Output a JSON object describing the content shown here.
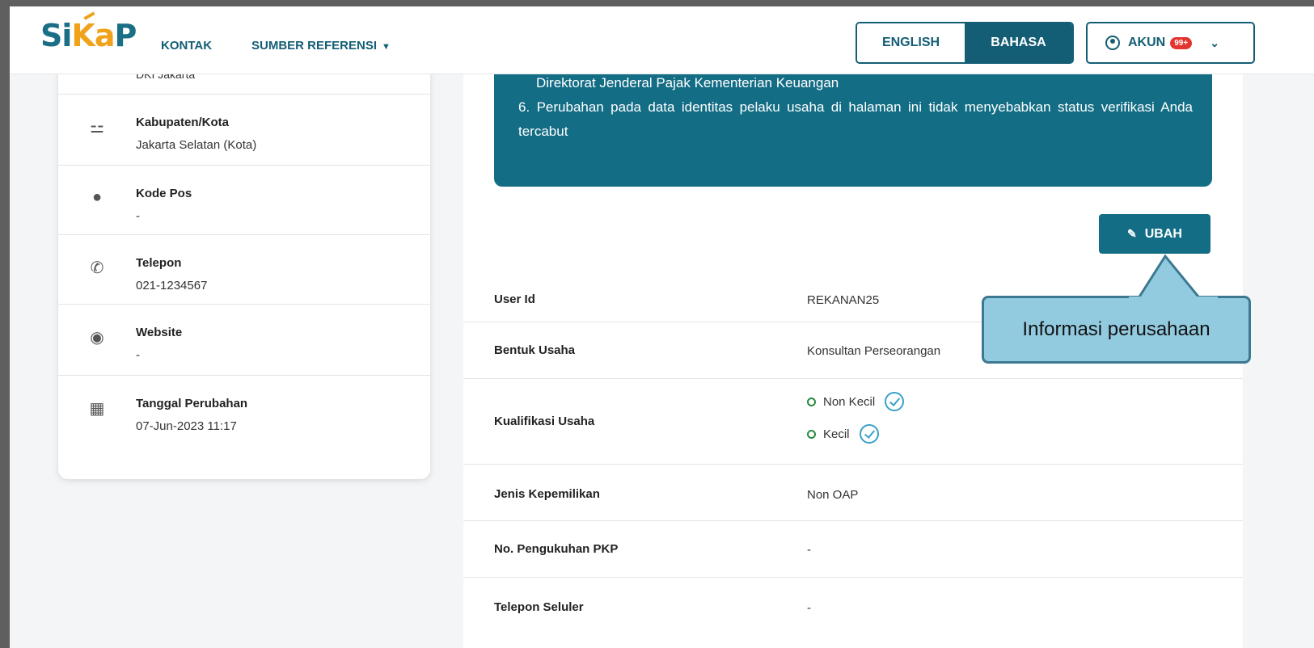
{
  "header": {
    "logo_text": "SiKaP",
    "nav": {
      "kontak": "KONTAK",
      "sumber_referensi": "SUMBER REFERENSI"
    },
    "lang": {
      "english": "ENGLISH",
      "bahasa": "BAHASA"
    },
    "akun": {
      "label": "AKUN",
      "badge": "99+"
    }
  },
  "left_card": {
    "cut_text": "DKI Jakarta",
    "items": [
      {
        "label": "Kabupaten/Kota",
        "value": "Jakarta Selatan (Kota)",
        "icon": "signpost-icon"
      },
      {
        "label": "Kode Pos",
        "value": "-",
        "icon": "pin-icon"
      },
      {
        "label": "Telepon",
        "value": "021-1234567",
        "icon": "phone-icon"
      },
      {
        "label": "Website",
        "value": "-",
        "icon": "globe-icon"
      },
      {
        "label": "Tanggal Perubahan",
        "value": "07-Jun-2023 11:17",
        "icon": "calendar-icon"
      }
    ]
  },
  "notice": {
    "line1": "Direktorat Jenderal Pajak Kementerian Keuangan",
    "item6": "6. Perubahan pada data identitas pelaku usaha di halaman ini tidak menyebabkan status verifikasi Anda tercabut"
  },
  "ubah_label": "UBAH",
  "details": {
    "user_id": {
      "label": "User Id",
      "value": "REKANAN25"
    },
    "bentuk_usaha": {
      "label": "Bentuk Usaha",
      "value": "Konsultan Perseorangan"
    },
    "kualifikasi": {
      "label": "Kualifikasi Usaha",
      "options": [
        "Non Kecil",
        "Kecil"
      ]
    },
    "jenis_kepemilikan": {
      "label": "Jenis Kepemilikan",
      "value": "Non OAP"
    },
    "no_pkp": {
      "label": "No. Pengukuhan PKP",
      "value": "-"
    },
    "telepon_seluler": {
      "label": "Telepon Seluler",
      "value": "-"
    }
  },
  "callout": {
    "text": "Informasi perusahaan"
  },
  "colors": {
    "primary": "#136d85",
    "accent": "#f0a21b",
    "callout_bg": "#92cbe0"
  }
}
